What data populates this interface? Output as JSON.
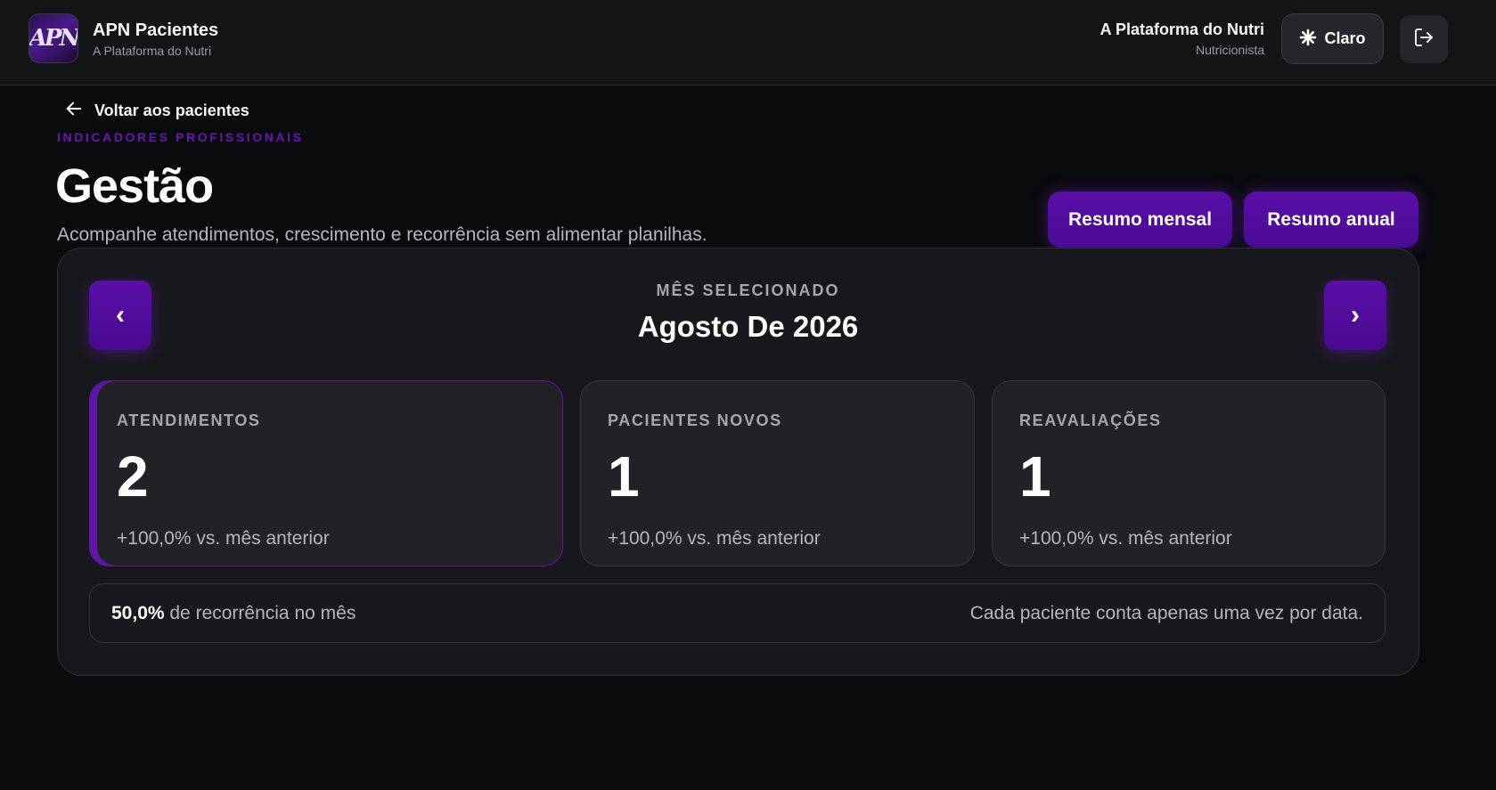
{
  "header": {
    "brand_title": "APN Pacientes",
    "brand_subtitle": "A Plataforma do Nutri",
    "logo_text": "APN",
    "user_name": "A Plataforma do Nutri",
    "user_role": "Nutricionista",
    "theme_button_label": "Claro",
    "theme_icon": "sun-icon",
    "logout_icon": "logout-icon"
  },
  "back_link": {
    "label": "Voltar aos pacientes",
    "icon": "arrow-left-icon"
  },
  "page": {
    "eyebrow": "INDICADORES PROFISSIONAIS",
    "title": "Gestão",
    "description": "Acompanhe atendimentos, crescimento e recorrência sem alimentar planilhas."
  },
  "actions": {
    "monthly_summary": "Resumo mensal",
    "annual_summary": "Resumo anual"
  },
  "month_selector": {
    "label": "MÊS SELECIONADO",
    "value": "Agosto De 2026",
    "prev_symbol": "‹",
    "next_symbol": "›"
  },
  "metrics": [
    {
      "label": "ATENDIMENTOS",
      "value": "2",
      "delta": "+100,0% vs. mês anterior"
    },
    {
      "label": "PACIENTES NOVOS",
      "value": "1",
      "delta": "+100,0% vs. mês anterior"
    },
    {
      "label": "REAVALIAÇÕES",
      "value": "1",
      "delta": "+100,0% vs. mês anterior"
    }
  ],
  "recurrence": {
    "percent": "50,0%",
    "text": " de recorrência no mês",
    "note": "Cada paciente conta apenas uma vez por data."
  },
  "colors": {
    "accent": "#5a0fa8",
    "eyebrow": "#6a14b8",
    "background": "#0a0b0d",
    "panel": "#17181b",
    "card": "#202226"
  }
}
